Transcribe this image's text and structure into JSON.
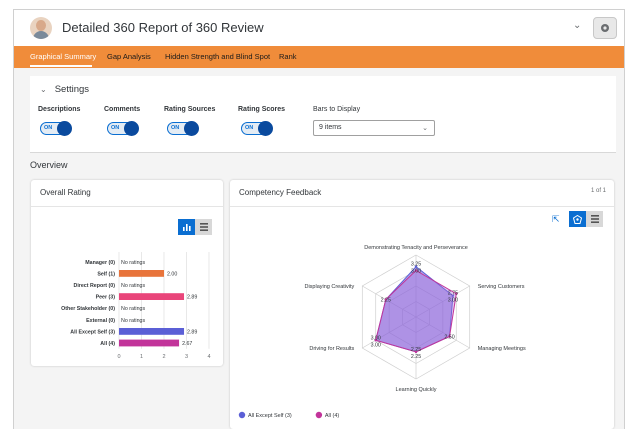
{
  "header": {
    "title": "Detailed 360 Report of 360 Review",
    "avatar_icon": "user-avatar-icon",
    "dropdown_icon": "chevron-down-icon",
    "action_icon": "settings-globe-icon"
  },
  "tabs": [
    {
      "label": "Graphical Summary",
      "active": true
    },
    {
      "label": "Gap Analysis",
      "active": false
    },
    {
      "label": "Hidden Strength and Blind Spot",
      "active": false
    },
    {
      "label": "Rank",
      "active": false
    }
  ],
  "settings": {
    "title": "Settings",
    "toggles": [
      {
        "label": "Descriptions",
        "state": "ON"
      },
      {
        "label": "Comments",
        "state": "ON"
      },
      {
        "label": "Rating Sources",
        "state": "ON"
      },
      {
        "label": "Rating Scores",
        "state": "ON"
      }
    ],
    "bars_label": "Bars to Display",
    "bars_value": "9 items"
  },
  "overview": {
    "title": "Overview"
  },
  "overall_rating": {
    "title": "Overall Rating",
    "chart_data": {
      "type": "bar",
      "orientation": "horizontal",
      "categories": [
        "Manager (0)",
        "Self (1)",
        "Direct Report (0)",
        "Peer (3)",
        "Other Stakeholder (0)",
        "External (0)",
        "All Except Self (3)",
        "All (4)"
      ],
      "values": [
        null,
        2.0,
        null,
        2.89,
        null,
        null,
        2.89,
        2.67
      ],
      "value_labels": [
        "No ratings",
        "2.00",
        "No ratings",
        "2.89",
        "No ratings",
        "No ratings",
        "2.89",
        "2.67"
      ],
      "colors": [
        "#000000",
        "#e8743b",
        "#000000",
        "#e9457a",
        "#000000",
        "#000000",
        "#5b5fd6",
        "#c2349a"
      ],
      "xticks": [
        "0",
        "1",
        "2",
        "3",
        "4"
      ],
      "xlim": [
        0,
        4
      ]
    }
  },
  "competency": {
    "title": "Competency Feedback",
    "paging": "1 of 1",
    "chart_data": {
      "type": "radar",
      "axes": [
        "Demonstrating Tenacity and Perseverance",
        "Serving Customers",
        "Managing Meetings",
        "Learning Quickly",
        "Driving for Results",
        "Displaying Creativity"
      ],
      "range": [
        0,
        4
      ],
      "series": [
        {
          "name": "All Except Self (3)",
          "color": "#5b5fd6",
          "values": [
            3.25,
            2.75,
            2.5,
            2.25,
            3.0,
            2.25
          ]
        },
        {
          "name": "All (4)",
          "color": "#c2349a",
          "values": [
            3.0,
            3.0,
            2.5,
            2.25,
            3.0,
            2.25
          ]
        }
      ],
      "value_labels": [
        [
          "3.25",
          "3.00"
        ],
        [
          "2.75",
          "3.00"
        ],
        [
          "2.50"
        ],
        [
          "2.25",
          "2.25"
        ],
        [
          "3.00",
          "3.00"
        ],
        [
          "2.25"
        ]
      ]
    }
  }
}
